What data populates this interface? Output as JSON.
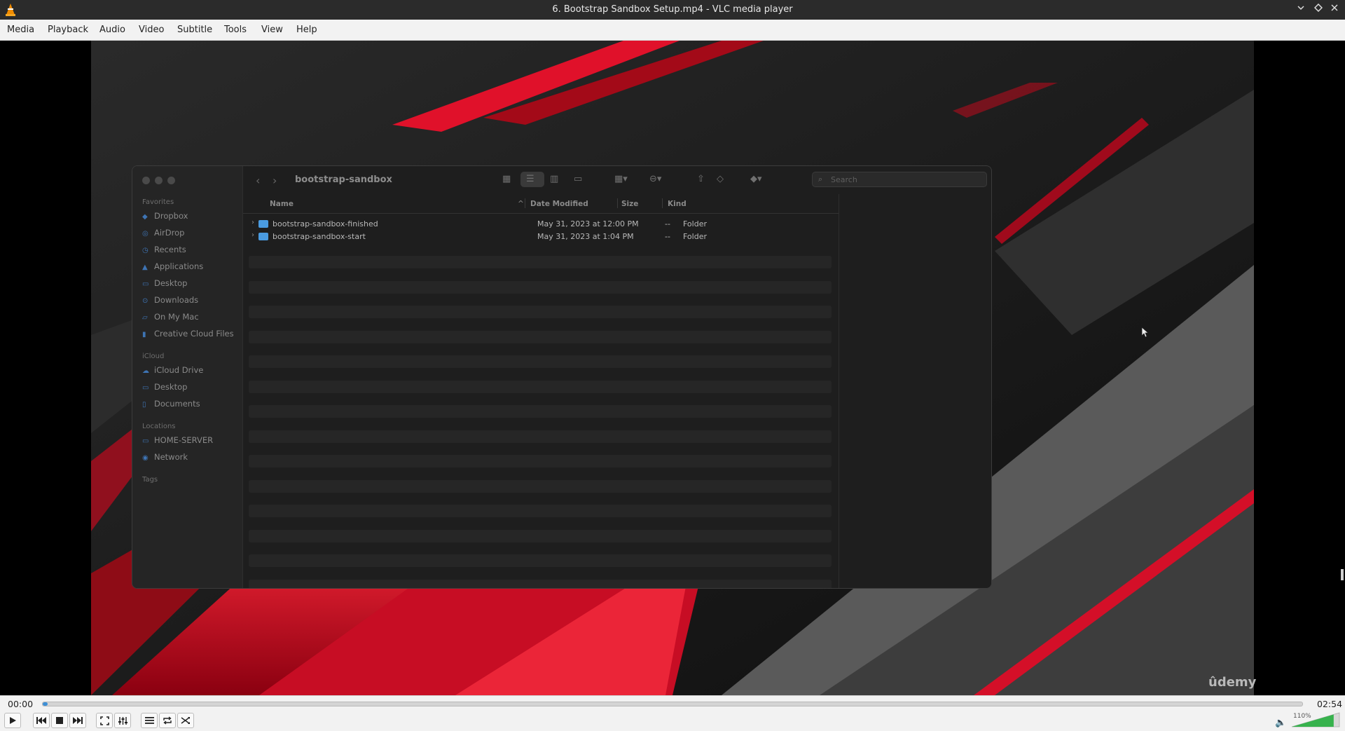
{
  "window": {
    "title": "6. Bootstrap Sandbox Setup.mp4 - VLC media player"
  },
  "menu": [
    "Media",
    "Playback",
    "Audio",
    "Video",
    "Subtitle",
    "Tools",
    "View",
    "Help"
  ],
  "finder": {
    "path": "bootstrap-sandbox",
    "search_placeholder": "Search",
    "sidebar": {
      "favorites_label": "Favorites",
      "favorites": [
        "Dropbox",
        "AirDrop",
        "Recents",
        "Applications",
        "Desktop",
        "Downloads",
        "On My Mac",
        "Creative Cloud Files"
      ],
      "icloud_label": "iCloud",
      "icloud": [
        "iCloud Drive",
        "Desktop",
        "Documents"
      ],
      "locations_label": "Locations",
      "locations": [
        "HOME-SERVER",
        "Network"
      ],
      "tags_label": "Tags"
    },
    "columns": {
      "name": "Name",
      "date": "Date Modified",
      "size": "Size",
      "kind": "Kind"
    },
    "rows": [
      {
        "name": "bootstrap-sandbox-finished",
        "date": "May 31, 2023 at 12:00 PM",
        "size": "--",
        "kind": "Folder"
      },
      {
        "name": "bootstrap-sandbox-start",
        "date": "May 31, 2023 at 1:04 PM",
        "size": "--",
        "kind": "Folder"
      }
    ]
  },
  "watermark": "ûdemy",
  "playback": {
    "elapsed": "00:00",
    "total": "02:54",
    "progress_percent": 0.3,
    "volume_label": "110%",
    "volume_percent": 110
  },
  "colors": {
    "accent": "#3d8fd6",
    "folder": "#4a9be0",
    "video_red": "#d4102a"
  }
}
